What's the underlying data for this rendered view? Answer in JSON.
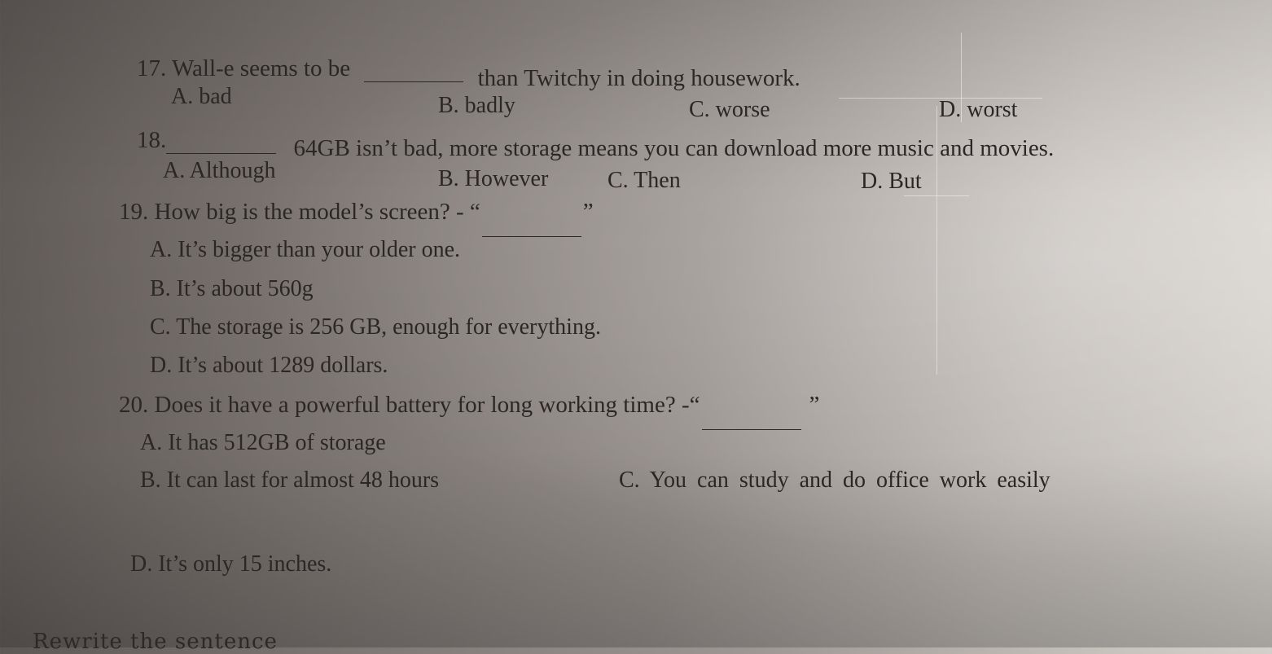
{
  "questions": [
    {
      "number": "17.",
      "stem_before": "Wall-e seems to be",
      "stem_after": "than Twitchy in doing housework.",
      "options": {
        "a": "A. bad",
        "b": "B. badly",
        "c": "C. worse",
        "d": "D. worst"
      }
    },
    {
      "number": "18.",
      "stem_after": "64GB isn’t bad, more storage means you can download more music and movies.",
      "options": {
        "a": "A. Although",
        "b": "B. However",
        "c": "C. Then",
        "d": "D. But"
      }
    },
    {
      "number": "19.",
      "stem_before": "How big is the model’s screen? - “",
      "stem_after": "”",
      "options": {
        "a": "A. It’s bigger than your older one.",
        "b": "B. It’s about 560g",
        "c": "C. The storage is 256 GB, enough for everything.",
        "d": "D. It’s about 1289 dollars."
      }
    },
    {
      "number": "20.",
      "stem_before": "Does it have a powerful battery for long working time? -“",
      "stem_after": "”",
      "options": {
        "a": "A. It has 512GB of storage",
        "b": "B. It can last for almost 48 hours",
        "c": "C.  You  can  study  and  do  office  work  easily",
        "d": "D. It’s only 15 inches."
      }
    }
  ],
  "section_heading": "Rewrite the sentence"
}
